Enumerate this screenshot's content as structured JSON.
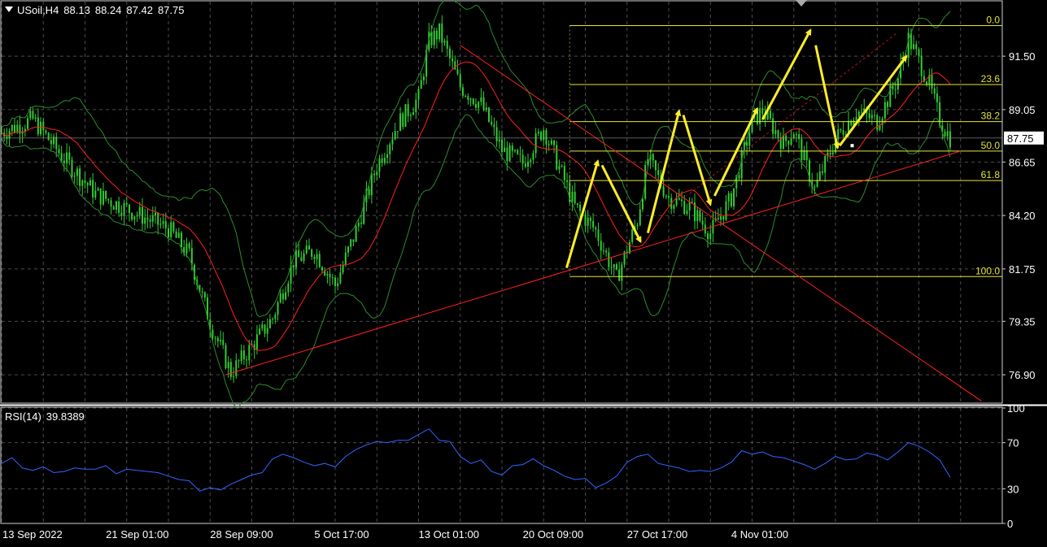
{
  "header": {
    "symbol": "USoil,H4",
    "open": "88.13",
    "high": "88.24",
    "low": "87.42",
    "close": "87.75"
  },
  "rsi_header": {
    "label": "RSI(14)",
    "value": "39.8389"
  },
  "colors": {
    "background": "#000000",
    "grid": "#8a8a8a",
    "candle": "#33cc33",
    "bollinger": "#2e8b2e",
    "ma": "#ff2020",
    "trendline": "#ff2020",
    "fibonacci": "#e6e63a",
    "arrows": "#ffee2a",
    "rsi_line": "#3366ff",
    "axis_text": "#ffffff"
  },
  "chart_data": [
    {
      "type": "candlestick",
      "title": "",
      "symbol": "USoil,H4",
      "price_axis_ticks": [
        "91.50",
        "89.05",
        "86.65",
        "84.20",
        "81.75",
        "79.35",
        "76.90"
      ],
      "current_price": "87.75",
      "ylim": [
        75.6,
        94.0
      ],
      "x_tick_labels": [
        "13 Sep 2022",
        "21 Sep 01:00",
        "28 Sep 09:00",
        "5 Oct 17:00",
        "13 Oct 01:00",
        "20 Oct 09:00",
        "27 Oct 17:00",
        "4 Nov 01:00"
      ],
      "price_path": [
        [
          0,
          88.0
        ],
        [
          3,
          88.6
        ],
        [
          6,
          86.8
        ],
        [
          9,
          85.2
        ],
        [
          12,
          84.5
        ],
        [
          16,
          83.6
        ],
        [
          18,
          82.4
        ],
        [
          20,
          79.3
        ],
        [
          22,
          77.0
        ],
        [
          24,
          78.2
        ],
        [
          26,
          79.5
        ],
        [
          28,
          82.1
        ],
        [
          30,
          82.6
        ],
        [
          32,
          81.0
        ],
        [
          34,
          83.5
        ],
        [
          36,
          86.5
        ],
        [
          38,
          88.4
        ],
        [
          40,
          89.6
        ],
        [
          41,
          92.2
        ],
        [
          42,
          92.6
        ],
        [
          44,
          90.1
        ],
        [
          46,
          89.3
        ],
        [
          48,
          87.2
        ],
        [
          50,
          86.6
        ],
        [
          52,
          88.2
        ],
        [
          55,
          84.6
        ],
        [
          57,
          83.5
        ],
        [
          59,
          81.3
        ],
        [
          61,
          84.0
        ],
        [
          62,
          86.8
        ],
        [
          64,
          85.0
        ],
        [
          66,
          84.6
        ],
        [
          68,
          83.4
        ],
        [
          70,
          85.0
        ],
        [
          72,
          88.5
        ],
        [
          73,
          89.0
        ],
        [
          75,
          87.5
        ],
        [
          76,
          88.1
        ],
        [
          78,
          85.4
        ],
        [
          80,
          87.7
        ],
        [
          82,
          89.0
        ],
        [
          84,
          88.5
        ],
        [
          86,
          90.5
        ],
        [
          87,
          92.3
        ],
        [
          88,
          91.3
        ],
        [
          89,
          90.2
        ],
        [
          90,
          88.6
        ],
        [
          91,
          87.75
        ]
      ],
      "series": [
        {
          "name": "",
          "indicator": "moving_average"
        },
        {
          "name": "",
          "indicator": "bollinger_bands"
        }
      ],
      "fibonacci_levels": [
        {
          "label": "0.0",
          "price": 92.9
        },
        {
          "label": "23.6",
          "price": 90.2
        },
        {
          "label": "38.2",
          "price": 88.5
        },
        {
          "label": "50.0",
          "price": 87.15
        },
        {
          "label": "61.8",
          "price": 85.8
        },
        {
          "label": "100.0",
          "price": 81.4
        }
      ],
      "trendlines": [
        {
          "color": "red",
          "from": [
            21.5,
            76.9
          ],
          "to": [
            92,
            87.15
          ]
        },
        {
          "color": "red",
          "from": [
            44,
            92.0
          ],
          "to": [
            94,
            75.7
          ]
        }
      ],
      "annotations": "yellow zigzag arrows tracing swings from 81.7 to 92.9, then projected pullback to ~87.2 and continuation upward"
    },
    {
      "type": "line",
      "title": "",
      "indicator": "RSI(14)",
      "last_value": "39.8389",
      "ylim": [
        0,
        100
      ],
      "y_tick_labels": [
        "100",
        "70",
        "30",
        "0"
      ],
      "levels": [
        70,
        30
      ],
      "points": [
        [
          0,
          52
        ],
        [
          1,
          57
        ],
        [
          2,
          48
        ],
        [
          3,
          46
        ],
        [
          4,
          49
        ],
        [
          5,
          44
        ],
        [
          6,
          45
        ],
        [
          7,
          48
        ],
        [
          8,
          47
        ],
        [
          9,
          47
        ],
        [
          10,
          50
        ],
        [
          11,
          43
        ],
        [
          12,
          47
        ],
        [
          13,
          46
        ],
        [
          14,
          45
        ],
        [
          15,
          44
        ],
        [
          16,
          41
        ],
        [
          17,
          38
        ],
        [
          18,
          37
        ],
        [
          19,
          28
        ],
        [
          20,
          31
        ],
        [
          21,
          29
        ],
        [
          22,
          34
        ],
        [
          23,
          38
        ],
        [
          24,
          42
        ],
        [
          25,
          44
        ],
        [
          26,
          56
        ],
        [
          27,
          60
        ],
        [
          28,
          57
        ],
        [
          29,
          53
        ],
        [
          30,
          50
        ],
        [
          31,
          52
        ],
        [
          32,
          49
        ],
        [
          33,
          58
        ],
        [
          34,
          64
        ],
        [
          35,
          68
        ],
        [
          36,
          71
        ],
        [
          37,
          70
        ],
        [
          38,
          72
        ],
        [
          39,
          72
        ],
        [
          40,
          77
        ],
        [
          41,
          82
        ],
        [
          42,
          72
        ],
        [
          43,
          71
        ],
        [
          44,
          58
        ],
        [
          45,
          52
        ],
        [
          46,
          55
        ],
        [
          47,
          45
        ],
        [
          48,
          42
        ],
        [
          49,
          50
        ],
        [
          50,
          51
        ],
        [
          51,
          56
        ],
        [
          52,
          50
        ],
        [
          53,
          46
        ],
        [
          54,
          41
        ],
        [
          55,
          38
        ],
        [
          56,
          39
        ],
        [
          57,
          31
        ],
        [
          58,
          35
        ],
        [
          59,
          41
        ],
        [
          60,
          53
        ],
        [
          61,
          58
        ],
        [
          62,
          60
        ],
        [
          63,
          52
        ],
        [
          64,
          50
        ],
        [
          65,
          48
        ],
        [
          66,
          45
        ],
        [
          67,
          46
        ],
        [
          68,
          45
        ],
        [
          69,
          48
        ],
        [
          70,
          53
        ],
        [
          71,
          63
        ],
        [
          72,
          60
        ],
        [
          73,
          62
        ],
        [
          74,
          58
        ],
        [
          75,
          57
        ],
        [
          76,
          54
        ],
        [
          77,
          51
        ],
        [
          78,
          47
        ],
        [
          79,
          52
        ],
        [
          80,
          58
        ],
        [
          81,
          55
        ],
        [
          82,
          56
        ],
        [
          83,
          61
        ],
        [
          84,
          59
        ],
        [
          85,
          55
        ],
        [
          86,
          62
        ],
        [
          87,
          70
        ],
        [
          88,
          67
        ],
        [
          89,
          62
        ],
        [
          90,
          55
        ],
        [
          91,
          40
        ]
      ]
    }
  ]
}
